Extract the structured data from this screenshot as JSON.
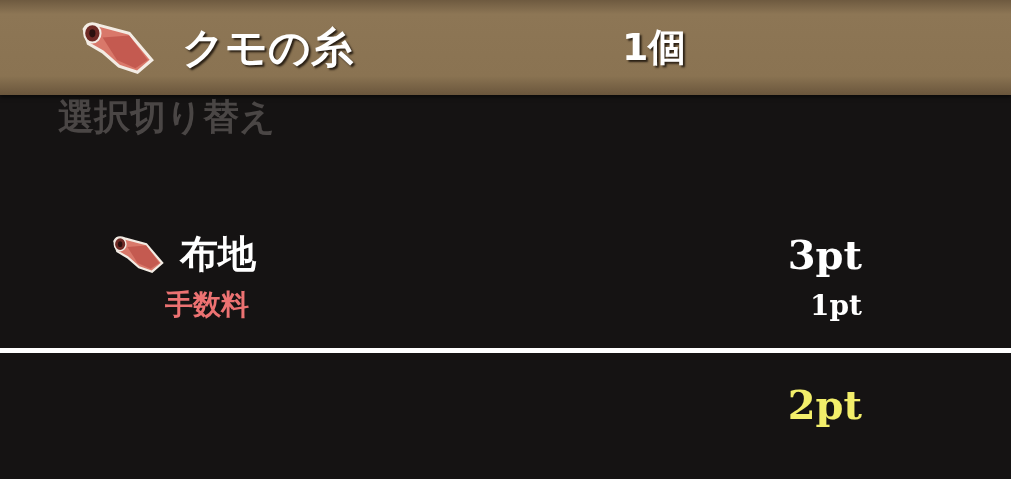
{
  "header": {
    "name": "クモの糸",
    "count": "1個"
  },
  "background_label": "選択切り替え",
  "material": {
    "name": "布地",
    "points": "3pt"
  },
  "fee": {
    "label": "手数料",
    "points": "1pt"
  },
  "total": {
    "points": "2pt"
  }
}
